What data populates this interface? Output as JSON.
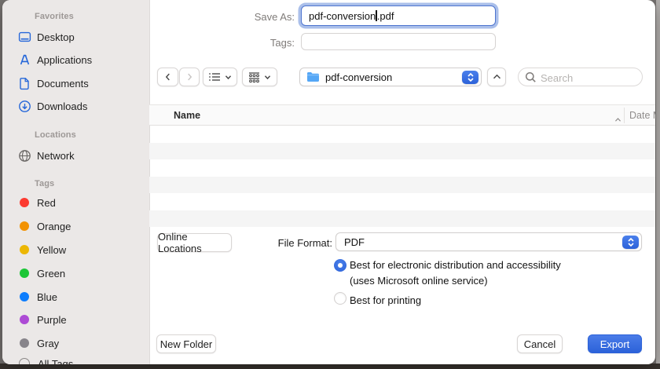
{
  "colors": {
    "accent_blue": "#2c62d9",
    "sidebar_icon_blue": "#2667d9",
    "folder_blue": "#55a7f6",
    "tag_red": "#fc3a30",
    "tag_orange": "#f29203",
    "tag_yellow": "#ecb704",
    "tag_green": "#1cc637",
    "tag_blue": "#0d7dfd",
    "tag_purple": "#ad4bd5",
    "tag_gray": "#87848a"
  },
  "sidebar": {
    "sections": [
      {
        "title": "Favorites",
        "items": [
          {
            "label": "Desktop"
          },
          {
            "label": "Applications"
          },
          {
            "label": "Documents"
          },
          {
            "label": "Downloads"
          }
        ]
      },
      {
        "title": "Locations",
        "items": [
          {
            "label": "Network"
          }
        ]
      },
      {
        "title": "Tags",
        "items": [
          {
            "label": "Red",
            "color": "#fc3a30"
          },
          {
            "label": "Orange",
            "color": "#f29203"
          },
          {
            "label": "Yellow",
            "color": "#ecb704"
          },
          {
            "label": "Green",
            "color": "#1cc637"
          },
          {
            "label": "Blue",
            "color": "#0d7dfd"
          },
          {
            "label": "Purple",
            "color": "#ad4bd5"
          },
          {
            "label": "Gray",
            "color": "#87848a"
          },
          {
            "label": "All Tags"
          }
        ]
      }
    ]
  },
  "sheet": {
    "save_as_label": "Save As:",
    "filename_before_caret": "pdf-conversion",
    "filename_after_caret": ".pdf",
    "tags_label": "Tags:",
    "folder_popup_value": "pdf-conversion",
    "search_placeholder": "Search",
    "column_name": "Name",
    "column_date_modified": "Date Modified",
    "online_locations_button": "Online Locations",
    "file_format_label": "File Format:",
    "file_format_value": "PDF",
    "radio_electronic_label": "Best for electronic distribution and accessibility",
    "radio_electronic_sub": "(uses Microsoft online service)",
    "radio_printing_label": "Best for printing",
    "new_folder_button": "New Folder",
    "cancel_button": "Cancel",
    "export_button": "Export"
  }
}
